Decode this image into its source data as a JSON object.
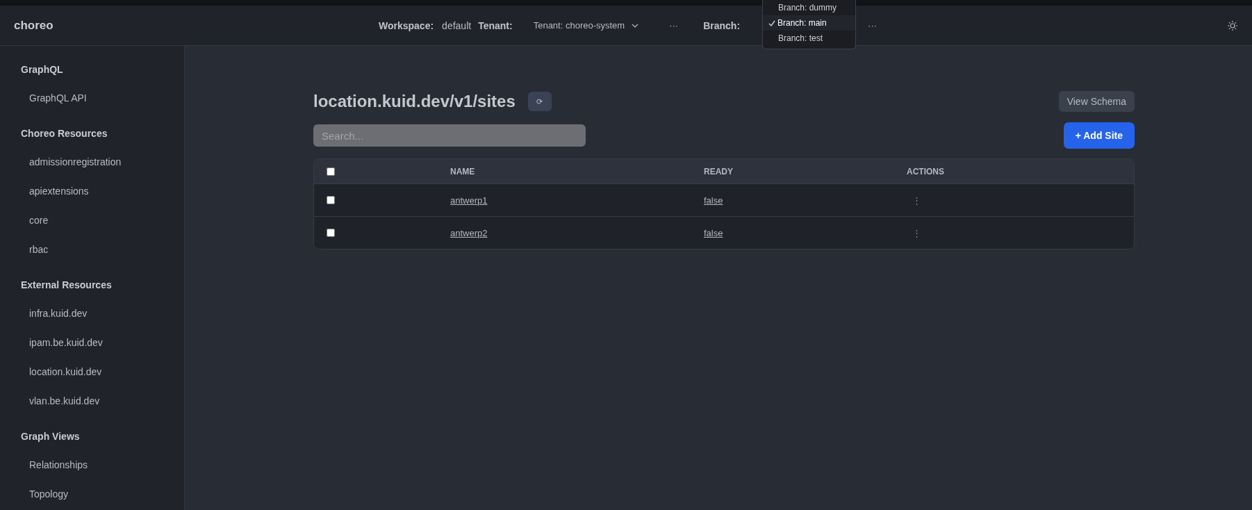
{
  "header": {
    "logo": "choreo",
    "workspace_label": "Workspace:",
    "workspace_value": "default",
    "tenant_label": "Tenant:",
    "tenant_select": "Tenant: choreo-system",
    "tenant_more": "···",
    "branch_label": "Branch:",
    "branch_more": "···"
  },
  "branch_menu": {
    "items": [
      {
        "label": "Branch: dummy",
        "selected": false
      },
      {
        "label": "Branch: main",
        "selected": true
      },
      {
        "label": "Branch: test",
        "selected": false
      }
    ]
  },
  "sidebar": {
    "sections": [
      {
        "title": "GraphQL",
        "items": [
          "GraphQL API"
        ]
      },
      {
        "title": "Choreo Resources",
        "items": [
          "admissionregistration",
          "apiextensions",
          "core",
          "rbac"
        ]
      },
      {
        "title": "External Resources",
        "items": [
          "infra.kuid.dev",
          "ipam.be.kuid.dev",
          "location.kuid.dev",
          "vlan.be.kuid.dev"
        ]
      },
      {
        "title": "Graph Views",
        "items": [
          "Relationships",
          "Topology"
        ]
      }
    ]
  },
  "page": {
    "title": "location.kuid.dev/v1/sites",
    "refresh": "⟳",
    "view_schema": "View Schema",
    "search": {
      "placeholder": "Search..."
    },
    "add_button": "+ Add Site"
  },
  "table": {
    "select_all": {
      "checked": false
    },
    "columns": [
      "NAME",
      "READY",
      "ACTIONS"
    ],
    "rows": [
      {
        "checked": false,
        "name": "antwerp1",
        "ready": "false",
        "actions": "⋮"
      },
      {
        "checked": false,
        "name": "antwerp2",
        "ready": "false",
        "actions": "⋮"
      }
    ]
  }
}
